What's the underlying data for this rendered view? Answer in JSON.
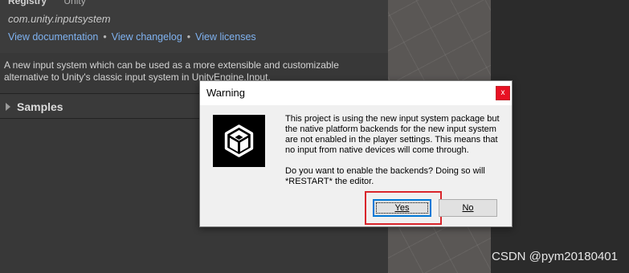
{
  "package_panel": {
    "registry_label": "Registry",
    "registry_value": "Unity",
    "package_id": "com.unity.inputsystem",
    "links": [
      "View documentation",
      "View changelog",
      "View licenses"
    ],
    "separator": "•",
    "description_line1": "A new input system which can be used as a more extensible and customizable",
    "description_line2": "alternative to Unity's classic input system in UnityEngine.Input.",
    "samples_label": "Samples"
  },
  "dialog": {
    "title": "Warning",
    "close_glyph": "x",
    "message_para1": "This project is using the new input system package but the native platform backends for the new input system are not enabled in the player settings. This means that no input from native devices will come through.",
    "message_para2": "Do you want to enable the backends? Doing so will *RESTART* the editor.",
    "yes_label": "Yes",
    "no_label": "No",
    "icon": "unity-logo-icon"
  },
  "watermark": "CSDN @pym20180401",
  "colors": {
    "link": "#7fb2f0",
    "highlight_border": "#d9262c",
    "close_button": "#e81123"
  }
}
